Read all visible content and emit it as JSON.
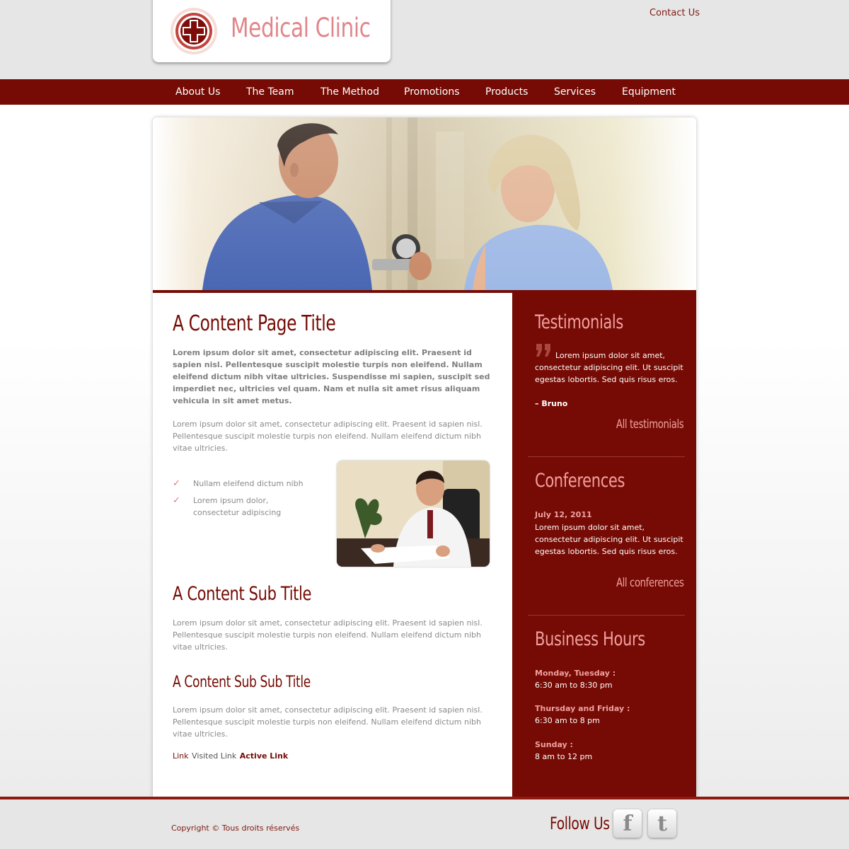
{
  "header": {
    "logo_text": "Medical Clinic",
    "contact_label": "Contact Us"
  },
  "nav": {
    "items": [
      "About Us",
      "The Team",
      "The Method",
      "Promotions",
      "Products",
      "Services",
      "Equipment"
    ]
  },
  "main": {
    "title": "A Content Page Title",
    "lead": "Lorem ipsum dolor sit amet, consectetur adipiscing elit. Praesent id sapien nisl. Pellentesque suscipit molestie turpis non eleifend. Nullam eleifend dictum nibh vitae ultricies. Suspendisse mi sapien, suscipit sed imperdiet nec, ultricies vel quam. Nam et nulla sit amet risus aliquam vehicula in sit amet metus.",
    "para1": "Lorem ipsum dolor sit amet, consectetur adipiscing elit. Praesent id sapien nisl. Pellentesque suscipit molestie turpis non eleifend. Nullam eleifend dictum nibh vitae ultricies.",
    "checklist": [
      "Nullam eleifend dictum nibh",
      "Lorem ipsum dolor, consectetur adipiscing"
    ],
    "sub_title": "A Content Sub Title",
    "para2": "Lorem ipsum dolor sit amet, consectetur adipiscing elit. Praesent id sapien nisl. Pellentesque suscipit molestie turpis non eleifend. Nullam eleifend dictum nibh vitae ultricies.",
    "sub_sub_title": "A Content Sub Sub Title",
    "para3": "Lorem ipsum dolor sit amet, consectetur adipiscing elit. Praesent id sapien nisl. Pellentesque suscipit molestie turpis non eleifend. Nullam eleifend dictum nibh vitae ultricies.",
    "links": {
      "link": "Link",
      "visited": "Visited Link",
      "active": "Active Link"
    }
  },
  "sidebar": {
    "testimonials": {
      "title": "Testimonials",
      "quote": "Lorem ipsum dolor sit amet, consectetur adipiscing elit. Ut suscipit egestas lobortis. Sed quis risus eros.",
      "author": "– Bruno",
      "more": "All testimonials"
    },
    "conferences": {
      "title": "Conferences",
      "date": "July 12, 2011",
      "text": "Lorem ipsum dolor sit amet, consectetur adipiscing elit. Ut suscipit egestas lobortis. Sed quis risus eros.",
      "more": "All conferences"
    },
    "hours": {
      "title": "Business Hours",
      "entries": [
        {
          "days": "Monday, Tuesday :",
          "time": "6:30 am to 8:30 pm"
        },
        {
          "days": "Thursday and Friday :",
          "time": "6:30 am to 8 pm"
        },
        {
          "days": "Sunday :",
          "time": "8 am to 12 pm"
        }
      ]
    }
  },
  "footer": {
    "copyright": "Copyright © Tous droits réservés",
    "follow_label": "Follow Us",
    "facebook_glyph": "f",
    "twitter_glyph": "t"
  },
  "colors": {
    "brand": "#750b04",
    "accent_pink": "#f0a0a0",
    "logo_pink": "#e0868b"
  }
}
